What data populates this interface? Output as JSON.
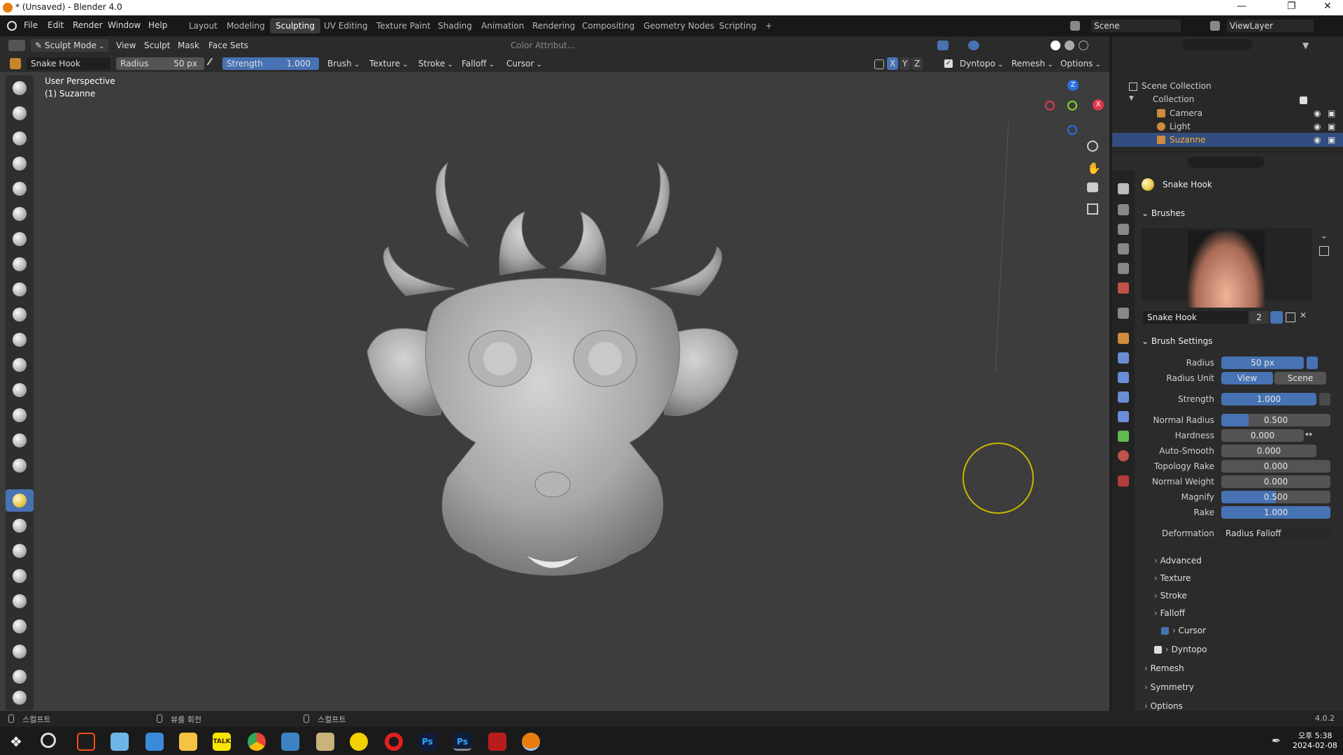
{
  "window": {
    "title": "* (Unsaved) - Blender 4.0"
  },
  "menu": [
    "File",
    "Edit",
    "Render",
    "Window",
    "Help"
  ],
  "workspaces": [
    "Layout",
    "Modeling",
    "Sculpting",
    "UV Editing",
    "Texture Paint",
    "Shading",
    "Animation",
    "Rendering",
    "Compositing",
    "Geometry Nodes",
    "Scripting",
    "+"
  ],
  "scene": "Scene",
  "view_layer": "ViewLayer",
  "header": {
    "mode": "Sculpt Mode",
    "items": [
      "View",
      "Sculpt",
      "Mask",
      "Face Sets"
    ],
    "color_attr": "Color Attribut..."
  },
  "tool": {
    "brush": "Snake Hook",
    "radius_label": "Radius",
    "radius_value": "50 px",
    "strength_label": "Strength",
    "strength_value": "1.000",
    "strength": 1.0,
    "dropdowns": [
      "Brush",
      "Texture",
      "Stroke",
      "Falloff",
      "Cursor"
    ],
    "axes": [
      "X",
      "Y",
      "Z"
    ],
    "dyntopo": "Dyntopo",
    "remesh": "Remesh",
    "options": "Options"
  },
  "viewport": {
    "line1": "User Perspective",
    "line2": "(1) Suzanne",
    "gizmo": {
      "z": "Z",
      "x": "X"
    }
  },
  "outliner": {
    "root": "Scene Collection",
    "collection": "Collection",
    "items": [
      "Camera",
      "Light",
      "Suzanne"
    ]
  },
  "properties": {
    "brush_name": "Snake Hook",
    "brushes_panel": "Brushes",
    "brush_slot": "Snake Hook",
    "brush_users": "2",
    "settings_panel": "Brush Settings",
    "fields": [
      {
        "label": "Radius",
        "value": "50 px",
        "fill": 1.0
      },
      {
        "label": "Strength",
        "value": "1.000",
        "fill": 1.0
      },
      {
        "label": "Normal Radius",
        "value": "0.500",
        "fill": 0.25
      },
      {
        "label": "Hardness",
        "value": "0.000",
        "fill": 0
      },
      {
        "label": "Auto-Smooth",
        "value": "0.000",
        "fill": 0
      },
      {
        "label": "Topology Rake",
        "value": "0.000",
        "fill": 0
      },
      {
        "label": "Normal Weight",
        "value": "0.000",
        "fill": 0
      },
      {
        "label": "Magnify",
        "value": "0.500",
        "fill": 0.5
      },
      {
        "label": "Rake",
        "value": "1.000",
        "fill": 1.0
      }
    ],
    "radius_unit": {
      "label": "Radius Unit",
      "view": "View",
      "scene": "Scene"
    },
    "deformation": {
      "label": "Deformation",
      "value": "Radius Falloff"
    },
    "subsections": [
      "Advanced",
      "Texture",
      "Stroke",
      "Falloff",
      "Cursor"
    ],
    "panels": [
      "Dyntopo",
      "Remesh",
      "Symmetry",
      "Options"
    ]
  },
  "status": {
    "left": "스컬프트",
    "mid": "뷰를 회전",
    "right": "스컬프트",
    "version": "4.0.2"
  },
  "taskbar": {
    "time": "오후 5:38",
    "date": "2024-02-08",
    "kakao": "TALK",
    "ps": "Ps"
  },
  "colors": {
    "accent": "#4772b3",
    "viewport": "#3d3d3d"
  }
}
